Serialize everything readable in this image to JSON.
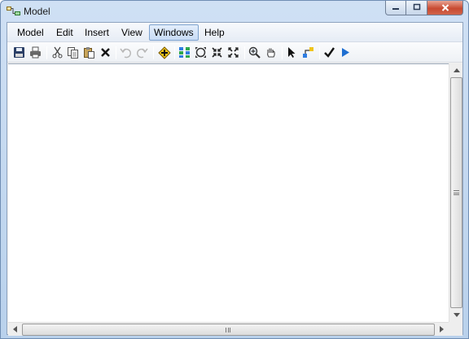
{
  "window": {
    "title": "Model",
    "app_icon": "model-builder-icon",
    "caption_buttons": {
      "minimize_icon": "minimize-icon",
      "maximize_icon": "maximize-icon",
      "close_icon": "close-icon",
      "close_color": "#c84a31"
    }
  },
  "menubar": {
    "items": [
      {
        "label": "Model"
      },
      {
        "label": "Edit"
      },
      {
        "label": "Insert"
      },
      {
        "label": "View"
      },
      {
        "label": "Windows",
        "active": true
      },
      {
        "label": "Help"
      }
    ]
  },
  "toolbar": {
    "buttons": [
      {
        "icon": "save-icon",
        "enabled": true
      },
      {
        "icon": "print-icon",
        "enabled": true
      },
      {
        "icon": "cut-icon",
        "enabled": true
      },
      {
        "icon": "copy-icon",
        "enabled": true
      },
      {
        "icon": "paste-icon",
        "enabled": true
      },
      {
        "icon": "delete-icon",
        "enabled": true
      },
      {
        "icon": "undo-icon",
        "enabled": false
      },
      {
        "icon": "redo-icon",
        "enabled": false
      },
      {
        "icon": "add-data-icon",
        "enabled": true
      },
      {
        "icon": "auto-layout-icon",
        "enabled": true
      },
      {
        "icon": "full-extent-icon",
        "enabled": true
      },
      {
        "icon": "fixed-zoom-in-icon",
        "enabled": true
      },
      {
        "icon": "fixed-zoom-out-icon",
        "enabled": true
      },
      {
        "icon": "zoom-in-icon",
        "enabled": true
      },
      {
        "icon": "pan-icon",
        "enabled": true
      },
      {
        "icon": "select-icon",
        "enabled": true
      },
      {
        "icon": "connect-icon",
        "enabled": true
      },
      {
        "icon": "validate-icon",
        "enabled": true
      },
      {
        "icon": "run-icon",
        "enabled": true
      }
    ],
    "accent_color": "#1f6fd1"
  },
  "scrollbars": {
    "vertical": {
      "up_icon": "arrow-up-icon",
      "down_icon": "arrow-down-icon"
    },
    "horizontal": {
      "left_icon": "arrow-left-icon",
      "right_icon": "arrow-right-icon"
    }
  }
}
